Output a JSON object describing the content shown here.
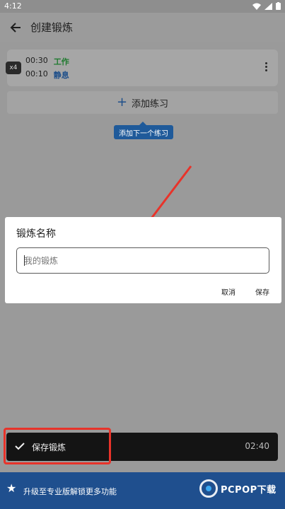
{
  "status_bar": {
    "time": "4:12"
  },
  "app_bar": {
    "title": "创建锻炼"
  },
  "workout": {
    "repeat": "x4",
    "intervals": [
      {
        "time": "00:30",
        "label": "工作"
      },
      {
        "time": "00:10",
        "label": "静息"
      }
    ]
  },
  "add_exercise": {
    "label": "添加练习"
  },
  "tooltip": {
    "text": "添加下一个练习"
  },
  "dialog": {
    "title": "锻炼名称",
    "input_value": "",
    "input_placeholder": "我的锻炼",
    "cancel": "取消",
    "save": "保存"
  },
  "snackbar": {
    "label": "保存锻炼",
    "total_time": "02:40"
  },
  "upgrade": {
    "text": "升级至专业版解锁更多功能"
  },
  "watermark": {
    "text": "PCPOP下载"
  },
  "colors": {
    "work": "#1f7a2f",
    "rest": "#1e4f8a",
    "annotation": "#e8332a",
    "banner": "#1f4f8e"
  },
  "icons": [
    "back-arrow-icon",
    "more-vert-icon",
    "plus-icon",
    "check-icon",
    "star-icon",
    "wifi-icon",
    "signal-icon",
    "battery-icon"
  ]
}
